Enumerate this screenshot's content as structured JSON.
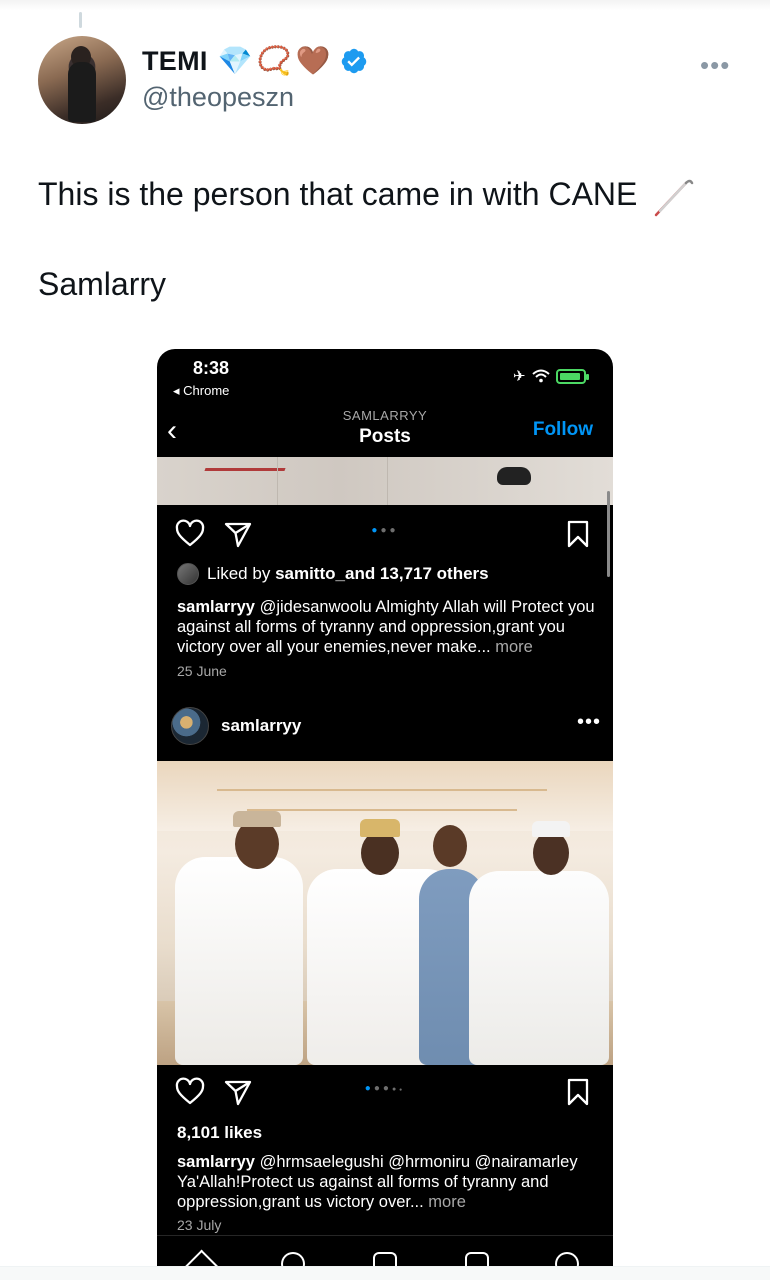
{
  "tweet": {
    "display_name": "TEMI",
    "name_emojis": [
      "💎",
      "📿",
      "🤎"
    ],
    "handle": "@theopeszn",
    "text_line1": "This is the person that came in with CANE",
    "text_line2": "Samlarry",
    "verified_color": "#1d9bf0"
  },
  "phone": {
    "status": {
      "time": "8:38",
      "back_app": "◂ Chrome"
    },
    "nav": {
      "subtitle": "SAMLARRYY",
      "title": "Posts",
      "follow": "Follow"
    },
    "post1": {
      "liked_by_prefix": "Liked by ",
      "liked_by_user": "samitto_",
      "liked_by_suffix": " and 13,717 others",
      "caption_user": "samlarryy",
      "caption_text": " @jidesanwoolu Almighty Allah will Protect you against all forms of tyranny and oppression,grant you victory over all your enemies,never make...",
      "more": " more",
      "date": "25 June"
    },
    "post2": {
      "username": "samlarryy",
      "likes": "8,101 likes",
      "caption_user": "samlarryy",
      "caption_text": " @hrmsaelegushi @hrmoniru @nairamarley Ya'Allah!Protect us against all forms of tyranny and oppression,grant us victory over...",
      "more": " more",
      "date": "23 July"
    },
    "accent": "#0095f6"
  }
}
